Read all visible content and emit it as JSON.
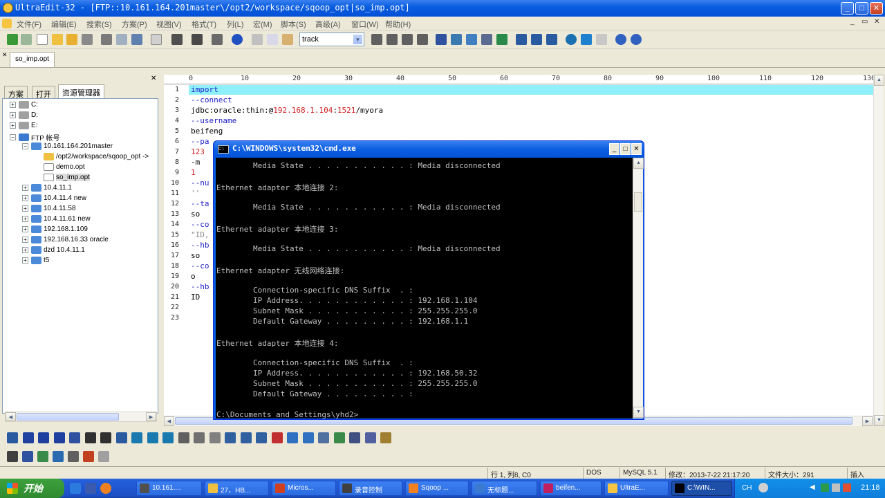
{
  "window": {
    "title": "UltraEdit-32 - [FTP::10.161.164.201master\\/opt2/workspace/sqoop_opt|so_imp.opt]",
    "min": "_",
    "max": "□",
    "close": "✕"
  },
  "menu": [
    "文件(F)",
    "编辑(E)",
    "搜索(S)",
    "方案(P)",
    "视图(V)",
    "格式(T)",
    "列(L)",
    "宏(M)",
    "脚本(S)",
    "高级(A)",
    "窗口(W)",
    "帮助(H)"
  ],
  "toolbar": {
    "combo_value": "track"
  },
  "doc_tab": "so_imp.opt",
  "left_panel": {
    "tabs": [
      "方案",
      "打开",
      "资源管理器"
    ],
    "tree": [
      {
        "label": "C:",
        "indent": 0,
        "pm": "+",
        "icon": "drive-icon"
      },
      {
        "label": "D:",
        "indent": 0,
        "pm": "+",
        "icon": "drive-icon"
      },
      {
        "label": "E:",
        "indent": 0,
        "pm": "+",
        "icon": "drive-icon"
      },
      {
        "label": "FTP 帐号",
        "indent": 0,
        "pm": "−",
        "icon": "ftp-icon"
      },
      {
        "label": "10.161.164.201master",
        "indent": 1,
        "pm": "−",
        "icon": "server-icon"
      },
      {
        "label": "/opt2/workspace/sqoop_opt ->",
        "indent": 2,
        "pm": "",
        "icon": "folder-icon"
      },
      {
        "label": "demo.opt",
        "indent": 2,
        "pm": "",
        "icon": "file-icon"
      },
      {
        "label": "so_imp.opt",
        "indent": 2,
        "pm": "",
        "icon": "file-icon",
        "selected": true
      },
      {
        "label": "10.4.11.1",
        "indent": 1,
        "pm": "+",
        "icon": "server-icon"
      },
      {
        "label": "10.4.11.4 new",
        "indent": 1,
        "pm": "+",
        "icon": "server-icon"
      },
      {
        "label": "10.4.11.58",
        "indent": 1,
        "pm": "+",
        "icon": "server-icon"
      },
      {
        "label": "10.4.11.61 new",
        "indent": 1,
        "pm": "+",
        "icon": "server-icon"
      },
      {
        "label": "192.168.1.109",
        "indent": 1,
        "pm": "+",
        "icon": "server-icon"
      },
      {
        "label": "192.168.16.33 oracle",
        "indent": 1,
        "pm": "+",
        "icon": "server-icon"
      },
      {
        "label": "dzd 10.4.11.1",
        "indent": 1,
        "pm": "+",
        "icon": "server-icon"
      },
      {
        "label": "t5",
        "indent": 1,
        "pm": "+",
        "icon": "server-icon"
      }
    ]
  },
  "ruler": [
    "0",
    "10",
    "20",
    "30",
    "40",
    "50",
    "60",
    "70",
    "80",
    "90",
    "100",
    "110",
    "120",
    "130"
  ],
  "editor": {
    "line_numbers": [
      "1",
      "2",
      "3",
      "4",
      "5",
      "6",
      "7",
      "8",
      "9",
      "10",
      "11",
      "12",
      "13",
      "14",
      "15",
      "16",
      "17",
      "18",
      "19",
      "20",
      "21",
      "22",
      "23"
    ],
    "lines": [
      [
        {
          "t": "import",
          "c": "blue"
        }
      ],
      [
        {
          "t": "--connect",
          "c": "blue"
        }
      ],
      [
        {
          "t": "jdbc:oracle:thin:@",
          "c": "black"
        },
        {
          "t": "192.168.1.104",
          "c": "red"
        },
        {
          "t": ":",
          "c": "black"
        },
        {
          "t": "1521",
          "c": "red"
        },
        {
          "t": "/myora",
          "c": "black"
        }
      ],
      [
        {
          "t": "--username",
          "c": "blue"
        }
      ],
      [
        {
          "t": "beifeng",
          "c": "black"
        }
      ],
      [
        {
          "t": "--pa",
          "c": "blue"
        }
      ],
      [
        {
          "t": "123",
          "c": "red"
        }
      ],
      [
        {
          "t": "-m",
          "c": "black"
        }
      ],
      [
        {
          "t": "1",
          "c": "red"
        }
      ],
      [
        {
          "t": "--nu",
          "c": "blue"
        }
      ],
      [
        {
          "t": "''",
          "c": "gray"
        }
      ],
      [
        {
          "t": "--ta",
          "c": "blue"
        }
      ],
      [
        {
          "t": "so",
          "c": "black"
        }
      ],
      [
        {
          "t": "--co",
          "c": "blue"
        }
      ],
      [
        {
          "t": "\"ID,",
          "c": "gray"
        }
      ],
      [
        {
          "t": "--hb",
          "c": "blue"
        }
      ],
      [
        {
          "t": "so",
          "c": "black"
        }
      ],
      [
        {
          "t": "--co",
          "c": "blue"
        }
      ],
      [
        {
          "t": "o",
          "c": "black"
        }
      ],
      [
        {
          "t": "--hb",
          "c": "blue"
        }
      ],
      [
        {
          "t": "ID",
          "c": "black"
        }
      ],
      [],
      []
    ]
  },
  "cmd": {
    "title": "C:\\WINDOWS\\system32\\cmd.exe",
    "lines": [
      "        Media State . . . . . . . . . . . : Media disconnected",
      "",
      "Ethernet adapter 本地连接 2:",
      "",
      "        Media State . . . . . . . . . . . : Media disconnected",
      "",
      "Ethernet adapter 本地连接 3:",
      "",
      "        Media State . . . . . . . . . . . : Media disconnected",
      "",
      "Ethernet adapter 无线网络连接:",
      "",
      "        Connection-specific DNS Suffix  . :",
      "        IP Address. . . . . . . . . . . . : 192.168.1.104",
      "        Subnet Mask . . . . . . . . . . . : 255.255.255.0",
      "        Default Gateway . . . . . . . . . : 192.168.1.1",
      "",
      "Ethernet adapter 本地连接 4:",
      "",
      "        Connection-specific DNS Suffix  . :",
      "        IP Address. . . . . . . . . . . . : 192.168.50.32",
      "        Subnet Mask . . . . . . . . . . . : 255.255.255.0",
      "        Default Gateway . . . . . . . . . :",
      "",
      "C:\\Documents and Settings\\yhd2>"
    ]
  },
  "status": {
    "position": "行 1, 列8, C0",
    "encoding": "DOS",
    "syntax": "MySQL 5.1",
    "modified": "修改：2013-7-22 21:17:20",
    "size": "文件大小：291",
    "mode": "插入"
  },
  "taskbar": {
    "start": "开始",
    "buttons": [
      "10.161....",
      "27、HB...",
      "Micros...",
      "录音控制",
      "Sqoop ...",
      "无标题...",
      "beifen...",
      "UltraE...",
      "C:\\WIN..."
    ],
    "lang": "CH",
    "clock": "21:18"
  }
}
